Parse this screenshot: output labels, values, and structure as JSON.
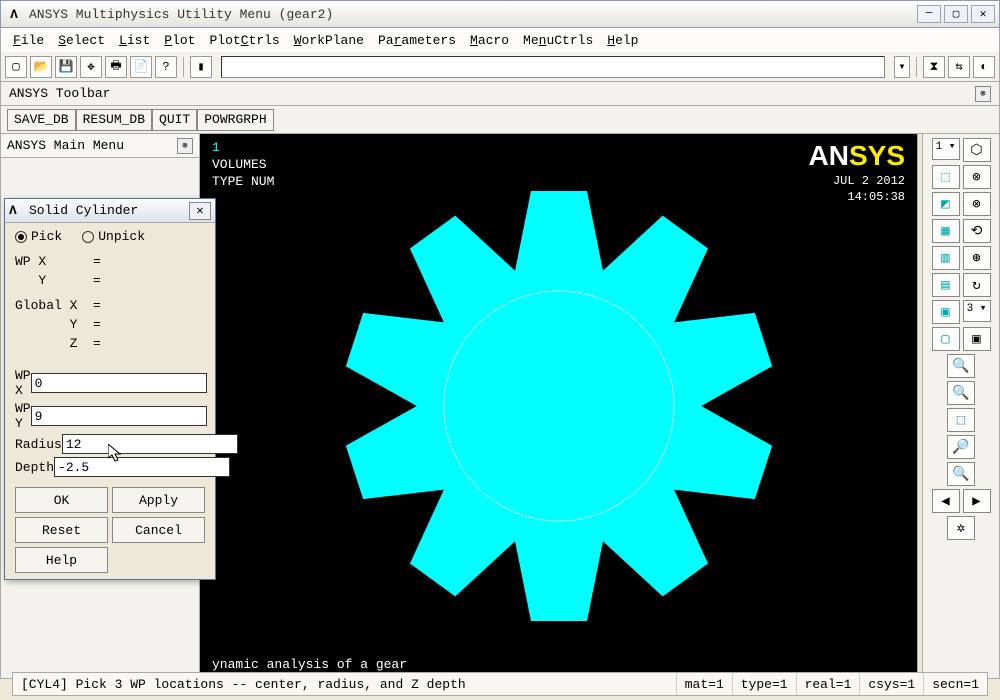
{
  "window": {
    "title": "ANSYS Multiphysics Utility Menu (gear2)"
  },
  "menubar": [
    "File",
    "Select",
    "List",
    "Plot",
    "PlotCtrls",
    "WorkPlane",
    "Parameters",
    "Macro",
    "MenuCtrls",
    "Help"
  ],
  "toolbar_label": "ANSYS Toolbar",
  "toolbar2": [
    "SAVE_DB",
    "RESUM_DB",
    "QUIT",
    "POWRGRPH"
  ],
  "main_menu_header": "ANSYS Main Menu",
  "viewport": {
    "index": "1",
    "line1": "VOLUMES",
    "line2": "TYPE NUM",
    "logo_white": "AN",
    "logo_yellow": "SYS",
    "date": "JUL  2 2012",
    "time": "14:05:38",
    "footer": "ynamic analysis of a gear"
  },
  "dialog": {
    "title": "Solid Cylinder",
    "pick": "Pick",
    "unpick": "Unpick",
    "wpx_lbl": "WP X      =",
    "wpy_lbl": "   Y      =",
    "gx_lbl": "Global X  =",
    "gy_lbl": "       Y  =",
    "gz_lbl": "       Z  =",
    "fields": {
      "wpx_label": "WP X",
      "wpx_value": "0",
      "wpy_label": "WP Y",
      "wpy_value": "9",
      "radius_label": "Radius",
      "radius_value": "12",
      "depth_label": "Depth",
      "depth_value": "-2.5"
    },
    "buttons": {
      "ok": "OK",
      "apply": "Apply",
      "reset": "Reset",
      "cancel": "Cancel",
      "help": "Help"
    }
  },
  "right": {
    "sel1": "1 ▾",
    "sel2": "3 ▾"
  },
  "status": {
    "prompt": "[CYL4]  Pick 3 WP locations -- center, radius, and Z depth",
    "mat": "mat=1",
    "type": "type=1",
    "real": "real=1",
    "csys": "csys=1",
    "secn": "secn=1"
  }
}
